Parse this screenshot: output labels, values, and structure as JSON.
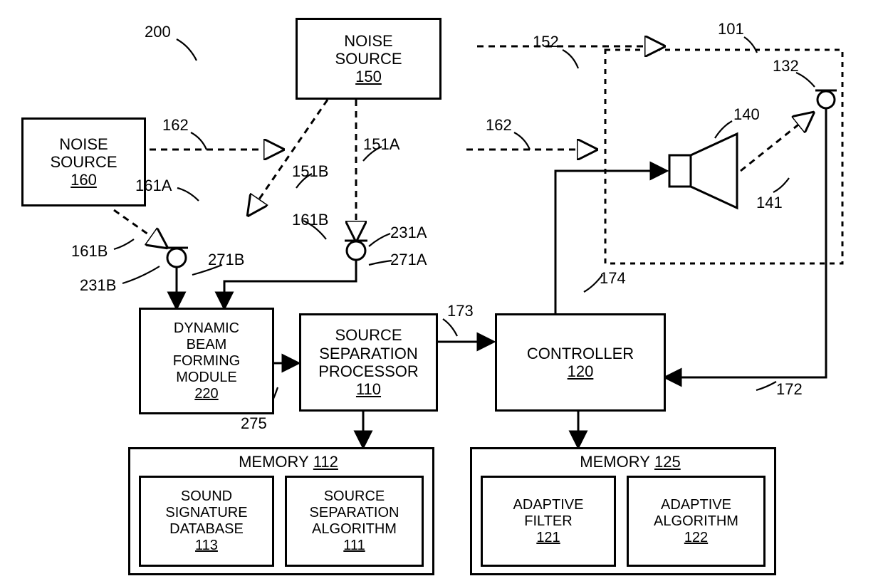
{
  "blocks": {
    "noise150": {
      "line1": "NOISE",
      "line2": "SOURCE",
      "num": "150"
    },
    "noise160": {
      "line1": "NOISE",
      "line2": "SOURCE",
      "num": "160"
    },
    "dbfm": {
      "line1": "DYNAMIC",
      "line2": "BEAM",
      "line3": "FORMING",
      "line4": "MODULE",
      "num": "220"
    },
    "ssp": {
      "line1": "SOURCE",
      "line2": "SEPARATION",
      "line3": "PROCESSOR",
      "num": "110"
    },
    "ctrl": {
      "line1": "CONTROLLER",
      "num": "120"
    },
    "mem112": {
      "title": "MEMORY",
      "num": "112"
    },
    "ssdb": {
      "line1": "SOUND",
      "line2": "SIGNATURE",
      "line3": "DATABASE",
      "num": "113"
    },
    "ssa": {
      "line1": "SOURCE",
      "line2": "SEPARATION",
      "line3": "ALGORITHM",
      "num": "111"
    },
    "mem125": {
      "title": "MEMORY",
      "num": "125"
    },
    "afilt": {
      "line1": "ADAPTIVE",
      "line2": "FILTER",
      "num": "121"
    },
    "aalg": {
      "line1": "ADAPTIVE",
      "line2": "ALGORITHM",
      "num": "122"
    }
  },
  "labels": {
    "l200": "200",
    "l152": "152",
    "l101": "101",
    "l162a": "162",
    "l162b": "162",
    "l132": "132",
    "l140": "140",
    "l151A": "151A",
    "l151B": "151B",
    "l161A": "161A",
    "l161B": "161B",
    "l231A": "231A",
    "l231B": "231B",
    "l271A": "271A",
    "l271B": "271B",
    "l141": "141",
    "l275": "275",
    "l173": "173",
    "l172": "172",
    "l174": "174"
  }
}
